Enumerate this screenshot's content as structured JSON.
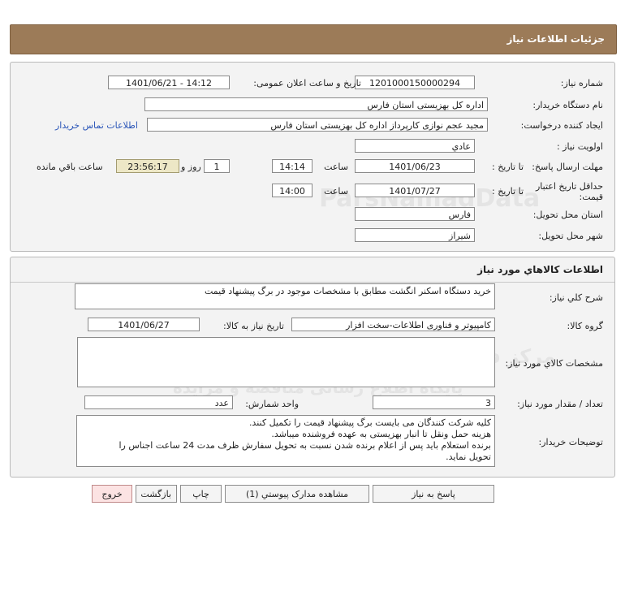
{
  "page": {
    "title": "جزئیات اطلاعات نیاز"
  },
  "watermark": {
    "line1": "مرکز فرآوری اطلاعات پارس نماد داده ها",
    "line2": "پایگاه اطلاع رسانی مناقصه و مزایده",
    "brand": "ParsNamadData"
  },
  "info": {
    "need_number_label": "شماره نیاز:",
    "need_number": "1201000150000294",
    "announce_label": "تاریخ و ساعت اعلان عمومی:",
    "announce_value": "1401/06/21 - 14:12",
    "buyer_label": "نام دستگاه خریدار:",
    "buyer_value": "اداره کل بهزیستی استان فارس",
    "creator_label": "ایجاد کننده درخواست:",
    "creator_value": "مجید عجم نوازی کارپرداز اداره کل بهزیستی استان فارس",
    "contact_link": "اطلاعات تماس خریدار",
    "priority_label": "اولویت نیاز :",
    "priority_value": "عادي",
    "deadline_label": "مهلت ارسال پاسخ:",
    "deadline_to": "تا تاریخ :",
    "deadline_date": "1401/06/23",
    "deadline_time_label": "ساعت",
    "deadline_time": "14:14",
    "days_value": "1",
    "days_label": "روز و",
    "remaining_time": "23:56:17",
    "remaining_label": "ساعت باقي مانده",
    "validity_label_1": "حداقل تاریخ اعتبار",
    "validity_label_2": "قیمت:",
    "validity_to": "تا تاریخ :",
    "validity_date": "1401/07/27",
    "validity_time_label": "ساعت",
    "validity_time": "14:00",
    "province_label": "استان محل تحویل:",
    "province_value": "فارس",
    "city_label": "شهر محل تحویل:",
    "city_value": "شیراز"
  },
  "goods": {
    "section_title": "اطلاعات کالاهاي مورد نياز",
    "desc_label": "شرح کلي نياز:",
    "desc_value": "خرید دستگاه اسکنر انگشت مطابق با مشخصات موجود در برگ پیشنهاد قیمت",
    "group_label": "گروه کالا:",
    "group_value": "کامپیوتر و فناوری اطلاعات-سخت افزار",
    "need_date_label": "تاریخ نياز به کالا:",
    "need_date": "1401/06/27",
    "specs_label": "مشخصات کالاي مورد نياز:",
    "specs_value": "",
    "qty_label": "تعداد / مقدار مورد نیاز:",
    "qty_value": "3",
    "unit_label": "واحد شمارش:",
    "unit_value": "عدد",
    "notes_label": "توضیحات خریدار:",
    "notes_lines": [
      "کلیه شرکت کنندگان می بایست برگ پیشنهاد قیمت را تکمیل کنند.",
      "هزینه حمل ونقل تا انبار بهزیستی به عهده فروشنده میباشد.",
      "برنده استعلام باید پس از اعلام برنده شدن نسبت به تحویل سفارش ظرف مدت 24 ساعت اجناس را",
      "تحویل نماید."
    ]
  },
  "buttons": {
    "reply": "پاسخ به نیاز",
    "attachments": "مشاهده مدارک پیوستي (1)",
    "print": "چاپ",
    "back": "بازگشت",
    "exit": "خروج"
  },
  "colors": {
    "title_bg": "#9c7b58",
    "timer_bg": "#ede7c6",
    "exit_bg": "#fce3e3",
    "link": "#2a55b8"
  }
}
